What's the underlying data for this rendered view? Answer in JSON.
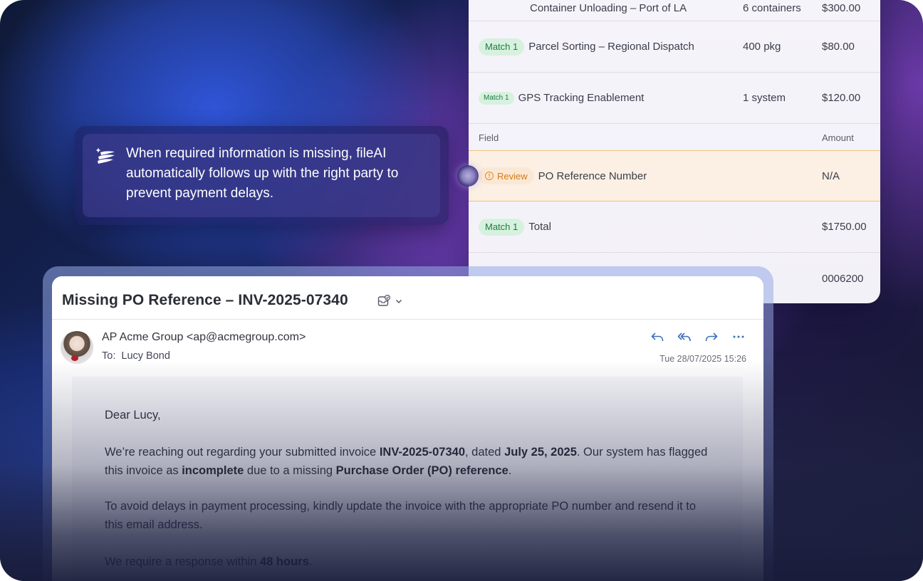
{
  "invoice_table": {
    "partial_row": {
      "item": "Container Unloading – Port of LA",
      "qty": "6 containers",
      "amount": "$300.00"
    },
    "rows": [
      {
        "badge": "Match 1",
        "item": "Parcel Sorting – Regional Dispatch",
        "qty": "400 pkg",
        "amount": "$80.00"
      },
      {
        "badge": "Match 1",
        "item": "GPS Tracking Enablement",
        "qty": "1 system",
        "amount": "$120.00"
      }
    ],
    "header": {
      "field": "Field",
      "amount": "Amount"
    },
    "review_row": {
      "badge": "Review",
      "field": "PO Reference Number",
      "amount": "N/A"
    },
    "total_row": {
      "badge": "Match 1",
      "field": "Total",
      "amount": "$1750.00"
    },
    "last_row": {
      "amount": "0006200"
    }
  },
  "callout": {
    "text": "When required information is missing, fileAI automatically follows up with the right party to prevent payment delays."
  },
  "email": {
    "subject": "Missing PO Reference – INV-2025-07340",
    "from": "AP Acme Group <ap@acmegroup.com>",
    "to_label": "To:",
    "to_name": "Lucy Bond",
    "date": "Tue 28/07/2025 15:26",
    "greeting": "Dear Lucy,",
    "p1": {
      "a": "We’re reaching out regarding your submitted invoice ",
      "b": "INV-2025-07340",
      "c": ", dated ",
      "d": "July 25, 2025",
      "e": ". Our system has flagged this invoice as ",
      "f": "incomplete",
      "g": " due to a missing ",
      "h": "Purchase Order (PO) reference",
      "i": "."
    },
    "p2": "To avoid delays in payment processing, kindly update the invoice with the appropriate PO number and resend it to this email address.",
    "p3": {
      "a": "We require a response within ",
      "b": "48 hours",
      "c": "."
    }
  },
  "colors": {
    "match_badge_bg": "#d7f1df",
    "match_badge_text": "#1f7a45",
    "review_badge_bg": "#fbe8d4",
    "review_badge_text": "#d47a16",
    "action_icon": "#3d6fb8"
  },
  "icons": [
    "sparkle-layers-icon",
    "tag-check-icon",
    "chevron-down-icon",
    "reply-icon",
    "reply-all-icon",
    "forward-icon",
    "more-icon",
    "warning-circle-icon"
  ]
}
